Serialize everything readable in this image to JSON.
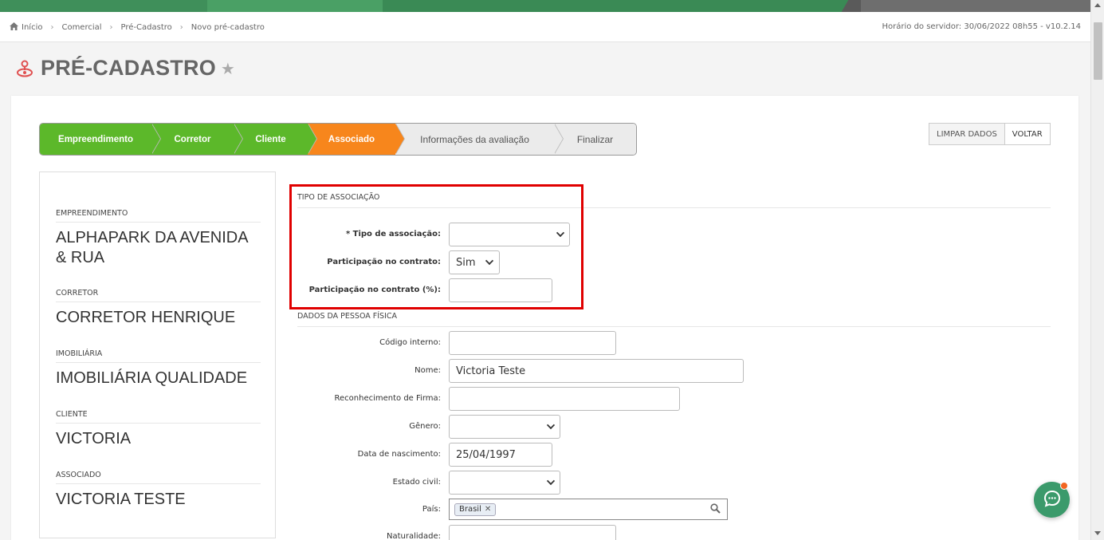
{
  "breadcrumb": {
    "items": [
      "Início",
      "Comercial",
      "Pré-Cadastro",
      "Novo pré-cadastro"
    ]
  },
  "server_time": "Horário do servidor: 30/06/2022 08h55 - v10.2.14",
  "page": {
    "title": "PRÉ-CADASTRO"
  },
  "steps": [
    {
      "label": "Empreendimento",
      "state": "done"
    },
    {
      "label": "Corretor",
      "state": "done"
    },
    {
      "label": "Cliente",
      "state": "done"
    },
    {
      "label": "Associado",
      "state": "active"
    },
    {
      "label": "Informações da avaliação",
      "state": "todo"
    },
    {
      "label": "Finalizar",
      "state": "todo"
    }
  ],
  "actions": {
    "clear_label": "LIMPAR DADOS",
    "back_label": "VOLTAR"
  },
  "summary": {
    "sections": [
      {
        "label": "EMPREENDIMENTO",
        "value": "ALPHAPARK DA AVENIDA & RUA"
      },
      {
        "label": "CORRETOR",
        "value": "CORRETOR HENRIQUE"
      },
      {
        "label": "IMOBILIÁRIA",
        "value": "IMOBILIÁRIA QUALIDADE"
      },
      {
        "label": "CLIENTE",
        "value": "VICTORIA"
      },
      {
        "label": "ASSOCIADO",
        "value": "VICTORIA TESTE"
      }
    ]
  },
  "association": {
    "section_title": "TIPO DE ASSOCIAÇÃO",
    "type_label": "* Tipo de associação:",
    "type_value": "",
    "participation_label": "Participação no contrato:",
    "participation_value": "Sim",
    "percent_label": "Participação no contrato (%):",
    "percent_value": ""
  },
  "person": {
    "section_title": "DADOS DA PESSOA FÍSICA",
    "internal_code_label": "Código interno:",
    "internal_code_value": "",
    "name_label": "Nome:",
    "name_value": "Victoria Teste",
    "signature_label": "Reconhecimento de Firma:",
    "signature_value": "",
    "gender_label": "Gênero:",
    "gender_value": "",
    "birth_label": "Data de nascimento:",
    "birth_value": "25/04/1997",
    "marital_label": "Estado civil:",
    "marital_value": "",
    "country_label": "País:",
    "country_tag": "Brasil",
    "naturality_label": "Naturalidade:",
    "naturality_value": ""
  },
  "colors": {
    "step_done": "#5cb82a",
    "step_active": "#f7861c",
    "highlight": "#e00000",
    "chat": "#3b9a6b"
  }
}
